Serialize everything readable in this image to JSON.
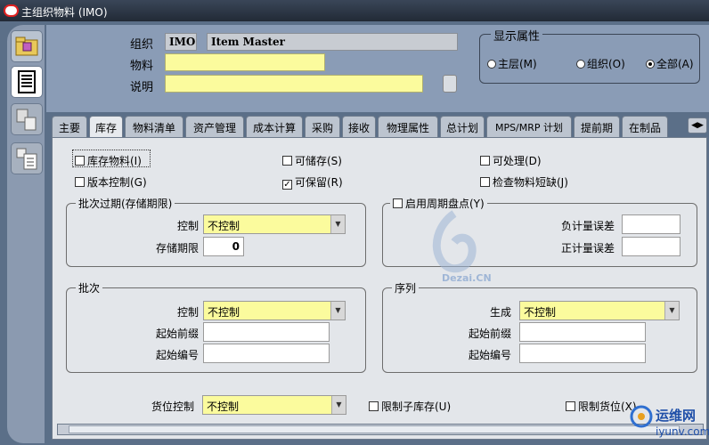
{
  "window": {
    "title": "主组织物料 (IMO)"
  },
  "header": {
    "org_label": "组织",
    "org_code": "IMO",
    "org_name": "Item Master",
    "item_label": "物料",
    "item_value": "",
    "desc_label": "说明",
    "desc_value": ""
  },
  "display_attrs": {
    "title": "显示属性",
    "options": [
      {
        "label": "主层(M)",
        "selected": false
      },
      {
        "label": "组织(O)",
        "selected": false
      },
      {
        "label": "全部(A)",
        "selected": true
      }
    ]
  },
  "tabs": [
    "主要",
    "库存",
    "物料清单",
    "资产管理",
    "成本计算",
    "采购",
    "接收",
    "物理属性",
    "总计划",
    "MPS/MRP 计划",
    "提前期",
    "在制品"
  ],
  "active_tab": "库存",
  "checks": {
    "inventory_item": {
      "label": "库存物料(I)",
      "checked": false
    },
    "stockable": {
      "label": "可储存(S)",
      "checked": false
    },
    "transactable": {
      "label": "可处理(D)",
      "checked": false
    },
    "revision_control": {
      "label": "版本控制(G)",
      "checked": false
    },
    "reservable": {
      "label": "可保留(R)",
      "checked": true
    },
    "check_shortages": {
      "label": "检查物料短缺(J)",
      "checked": false
    }
  },
  "lot_expiration": {
    "title": "批次过期(存储期限)",
    "control_label": "控制",
    "control_value": "不控制",
    "shelf_label": "存储期限",
    "shelf_value": "0"
  },
  "cycle_count": {
    "title": "启用周期盘点(Y)",
    "checked": false,
    "neg_label": "负计量误差",
    "neg_value": "",
    "pos_label": "正计量误差",
    "pos_value": ""
  },
  "lot": {
    "title": "批次",
    "control_label": "控制",
    "control_value": "不控制",
    "prefix_label": "起始前缀",
    "prefix_value": "",
    "number_label": "起始编号",
    "number_value": ""
  },
  "serial": {
    "title": "序列",
    "gen_label": "生成",
    "gen_value": "不控制",
    "prefix_label": "起始前缀",
    "prefix_value": "",
    "number_label": "起始编号",
    "number_value": ""
  },
  "locator": {
    "label": "货位控制",
    "value": "不控制",
    "restrict_subinv": {
      "label": "限制子库存(U)",
      "checked": false
    },
    "restrict_locators": {
      "label": "限制货位(X)",
      "checked": false
    }
  },
  "watermark": {
    "text": "Dezai.CN",
    "brand": "运维网",
    "domain": "iyunv.com"
  }
}
